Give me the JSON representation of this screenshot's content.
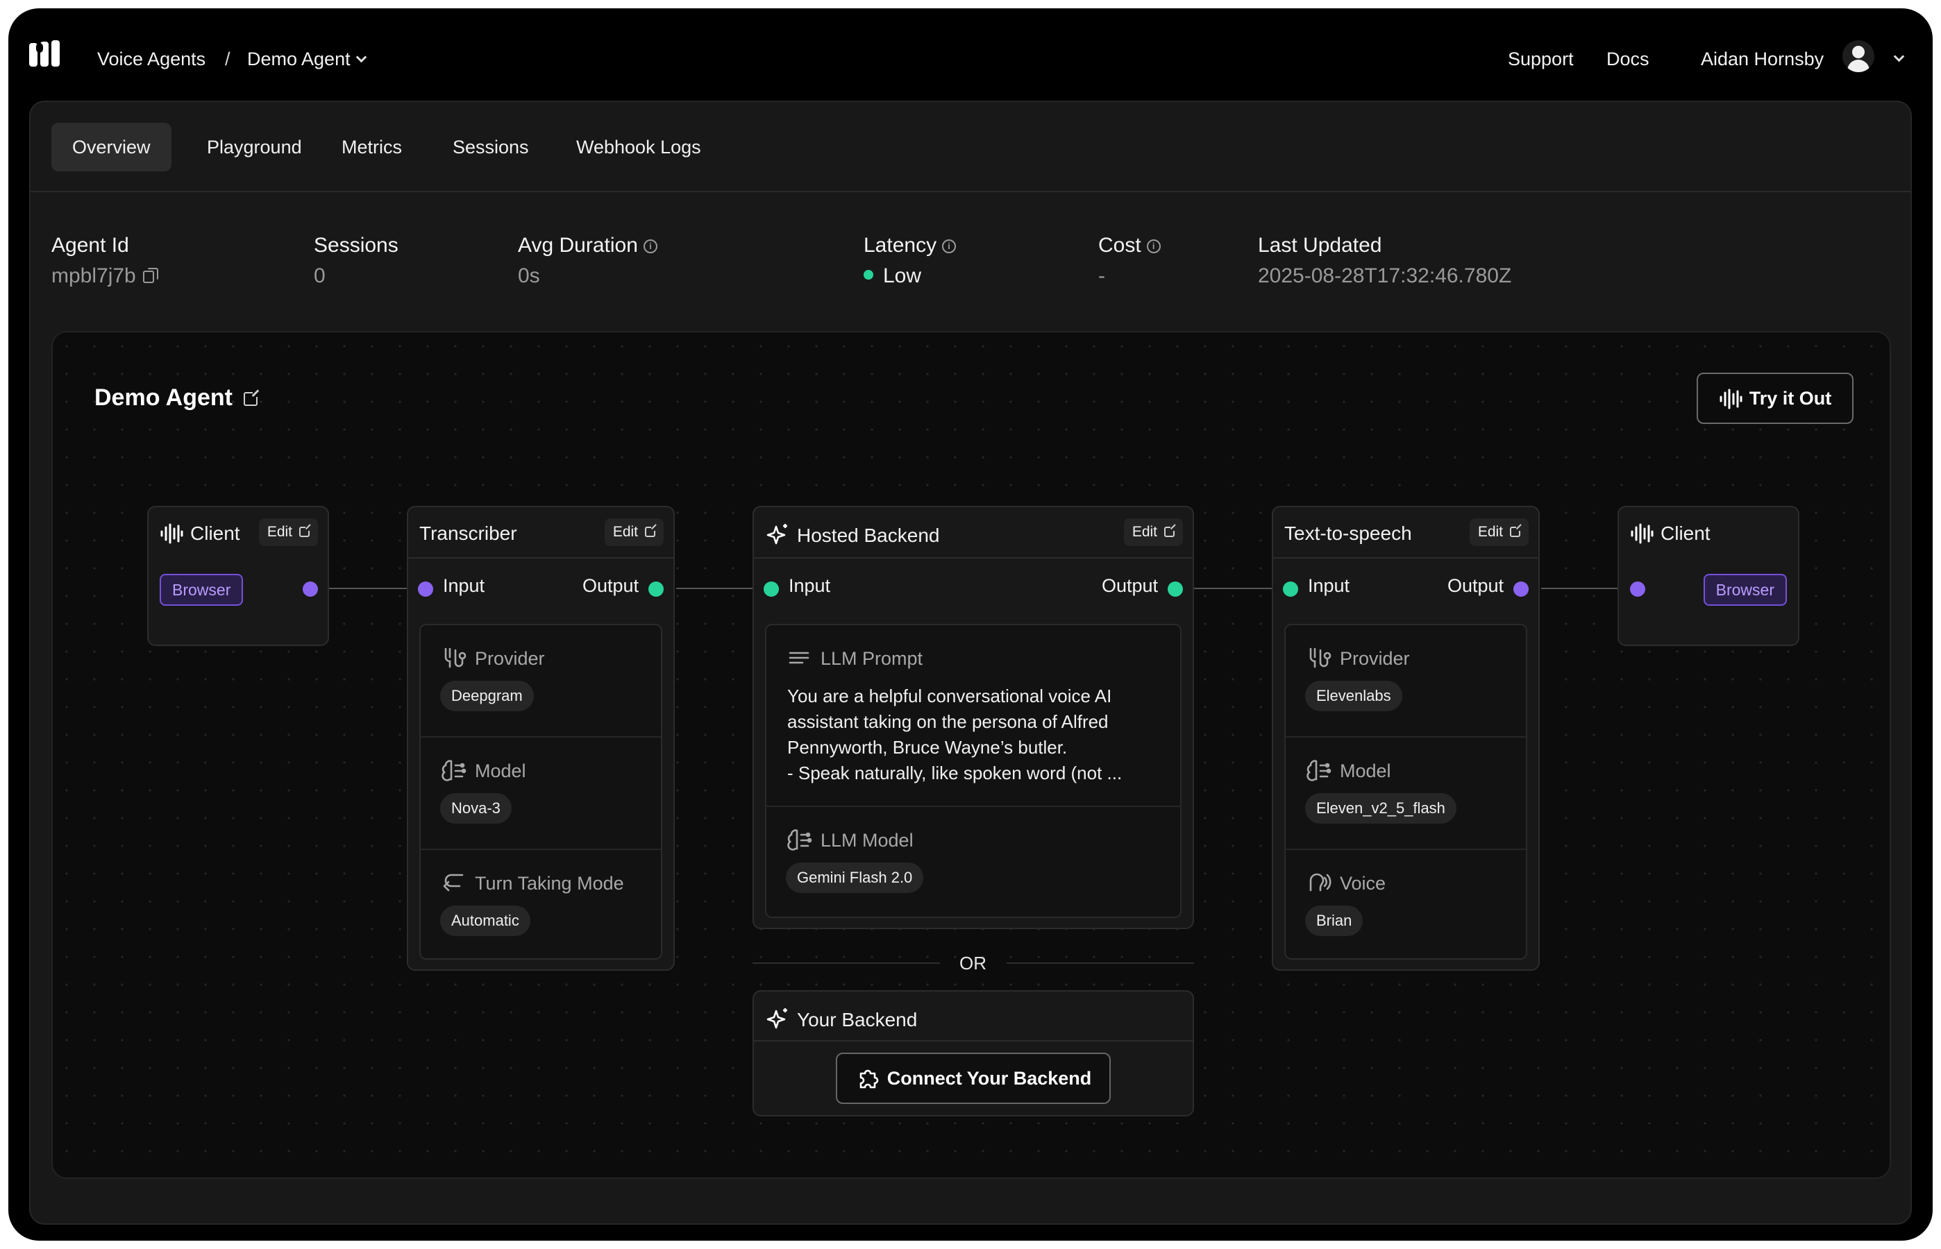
{
  "breadcrumb": {
    "root": "Voice Agents",
    "separator": "/",
    "current": "Demo Agent"
  },
  "topnav": {
    "support": "Support",
    "docs": "Docs",
    "user_name": "Aidan Hornsby"
  },
  "tabs": [
    "Overview",
    "Playground",
    "Metrics",
    "Sessions",
    "Webhook Logs"
  ],
  "active_tab": "Overview",
  "stats": {
    "agent_id": {
      "label": "Agent Id",
      "value": "mpbl7j7b"
    },
    "sessions": {
      "label": "Sessions",
      "value": "0"
    },
    "avg_duration": {
      "label": "Avg Duration",
      "value": "0s"
    },
    "latency": {
      "label": "Latency",
      "value": "Low"
    },
    "cost": {
      "label": "Cost",
      "value": "-"
    },
    "last_updated": {
      "label": "Last Updated",
      "value": "2025-08-28T17:32:46.780Z"
    }
  },
  "canvas": {
    "title": "Demo Agent",
    "try_button": "Try it Out"
  },
  "nodes": {
    "client_in": {
      "title": "Client",
      "edit": "Edit",
      "badge": "Browser"
    },
    "transcriber": {
      "title": "Transcriber",
      "edit": "Edit",
      "input": "Input",
      "output": "Output",
      "provider_label": "Provider",
      "provider": "Deepgram",
      "model_label": "Model",
      "model": "Nova-3",
      "turn_label": "Turn Taking Mode",
      "turn": "Automatic"
    },
    "hosted_backend": {
      "title": "Hosted Backend",
      "edit": "Edit",
      "input": "Input",
      "output": "Output",
      "prompt_label": "LLM Prompt",
      "prompt_line1": "You are a helpful conversational voice AI",
      "prompt_line2": "assistant taking on the persona of Alfred",
      "prompt_line3": "Pennyworth, Bruce Wayne’s butler.",
      "prompt_line4": "- Speak naturally, like spoken word (not ...",
      "llm_model_label": "LLM Model",
      "llm_model": "Gemini Flash 2.0"
    },
    "or_text": "OR",
    "your_backend": {
      "title": "Your Backend",
      "connect": "Connect Your Backend"
    },
    "tts": {
      "title": "Text-to-speech",
      "edit": "Edit",
      "input": "Input",
      "output": "Output",
      "provider_label": "Provider",
      "provider": "Elevenlabs",
      "model_label": "Model",
      "model": "Eleven_v2_5_flash",
      "voice_label": "Voice",
      "voice": "Brian"
    },
    "client_out": {
      "title": "Client",
      "badge": "Browser"
    }
  },
  "colors": {
    "accent_purple": "#8a63f0",
    "accent_green": "#28d39a",
    "background": "#000000"
  },
  "icons": [
    "logo-icon",
    "chevron-down-icon",
    "user-avatar-icon",
    "copy-icon",
    "info-icon",
    "external-link-icon",
    "waveform-icon",
    "sparkle-icon",
    "provider-icon",
    "brain-icon",
    "turn-icon",
    "lines-icon",
    "voice-icon",
    "puzzle-icon"
  ]
}
